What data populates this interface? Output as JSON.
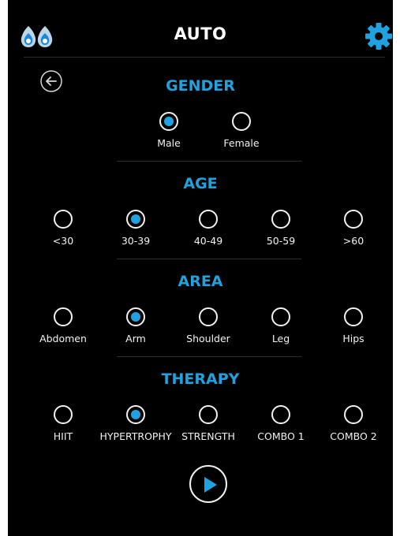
{
  "header": {
    "title": "AUTO"
  },
  "colors": {
    "accent": "#1ea2e0",
    "background": "#000000",
    "text": "#f2f2f2"
  },
  "icons": {
    "left": "water-drops-icon",
    "right": "gear-icon",
    "back": "back-arrow-icon",
    "play": "play-icon"
  },
  "gender": {
    "title": "GENDER",
    "options": [
      "Male",
      "Female"
    ],
    "selected": "Male"
  },
  "age": {
    "title": "AGE",
    "options": [
      "<30",
      "30-39",
      "40-49",
      "50-59",
      ">60"
    ],
    "selected": "30-39"
  },
  "area": {
    "title": "AREA",
    "options": [
      "Abdomen",
      "Arm",
      "Shoulder",
      "Leg",
      "Hips"
    ],
    "selected": "Arm"
  },
  "therapy": {
    "title": "THERAPY",
    "options": [
      "HIIT",
      "HYPERTROPHY",
      "STRENGTH",
      "COMBO 1",
      "COMBO 2"
    ],
    "selected": "HYPERTROPHY"
  }
}
